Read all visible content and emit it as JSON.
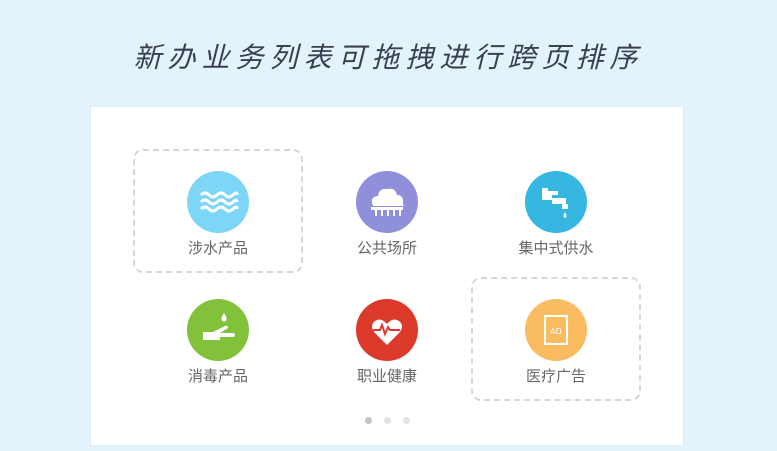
{
  "page": {
    "title": "新办业务列表可拖拽进行跨页排序"
  },
  "colors": {
    "background": "#e3f3fb",
    "panel": "#ffffff",
    "dashed_border": "#d7d7d7"
  },
  "tiles": [
    {
      "label": "涉水产品",
      "icon": "water-waves-icon",
      "color": "#7ed6f7",
      "dashed": true
    },
    {
      "label": "公共场所",
      "icon": "public-building-icon",
      "color": "#8f8fdc",
      "dashed": false
    },
    {
      "label": "集中式供水",
      "icon": "water-faucet-icon",
      "color": "#36b7e2",
      "dashed": false
    },
    {
      "label": "消毒产品",
      "icon": "hand-wash-icon",
      "color": "#82c13a",
      "dashed": false
    },
    {
      "label": "职业健康",
      "icon": "heartbeat-icon",
      "color": "#db3a2b",
      "dashed": false
    },
    {
      "label": "医疗广告",
      "icon": "ad-document-icon",
      "color": "#fbbb61",
      "dashed": true
    }
  ],
  "pagination": {
    "pages": 3,
    "current": 1
  }
}
